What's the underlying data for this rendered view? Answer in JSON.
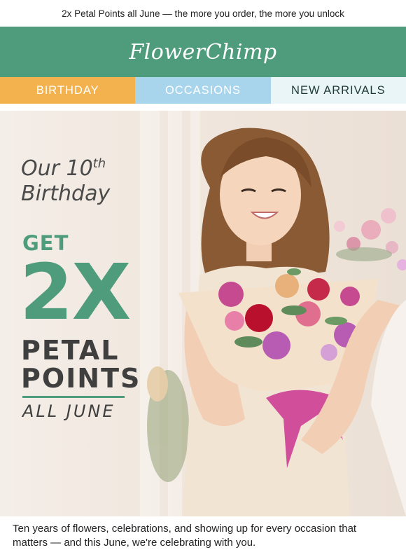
{
  "preheader": {
    "text": "2x Petal Points all June — the more you order, the more you unlock"
  },
  "brand": {
    "logo_text": "FlowerChimp",
    "color": "#4f9c7c"
  },
  "nav": {
    "items": [
      {
        "label": "BIRTHDAY",
        "color": "#f4b24e"
      },
      {
        "label": "OCCASIONS",
        "color": "#a8d4ec"
      },
      {
        "label": "NEW ARRIVALS",
        "color": "#eaf5f8"
      }
    ]
  },
  "hero": {
    "headline_prefix": "Our 10",
    "headline_sup": "th",
    "headline_line2": "Birthday",
    "get": "GET",
    "big": "2X",
    "petal": "PETAL",
    "points": "POINTS",
    "period": "ALL JUNE",
    "image_desc_icon": "woman-with-bouquet-photo"
  },
  "body": {
    "intro": "Ten years of flowers, celebrations, and showing up for every occasion that matters — and this June, we're celebrating with you."
  }
}
